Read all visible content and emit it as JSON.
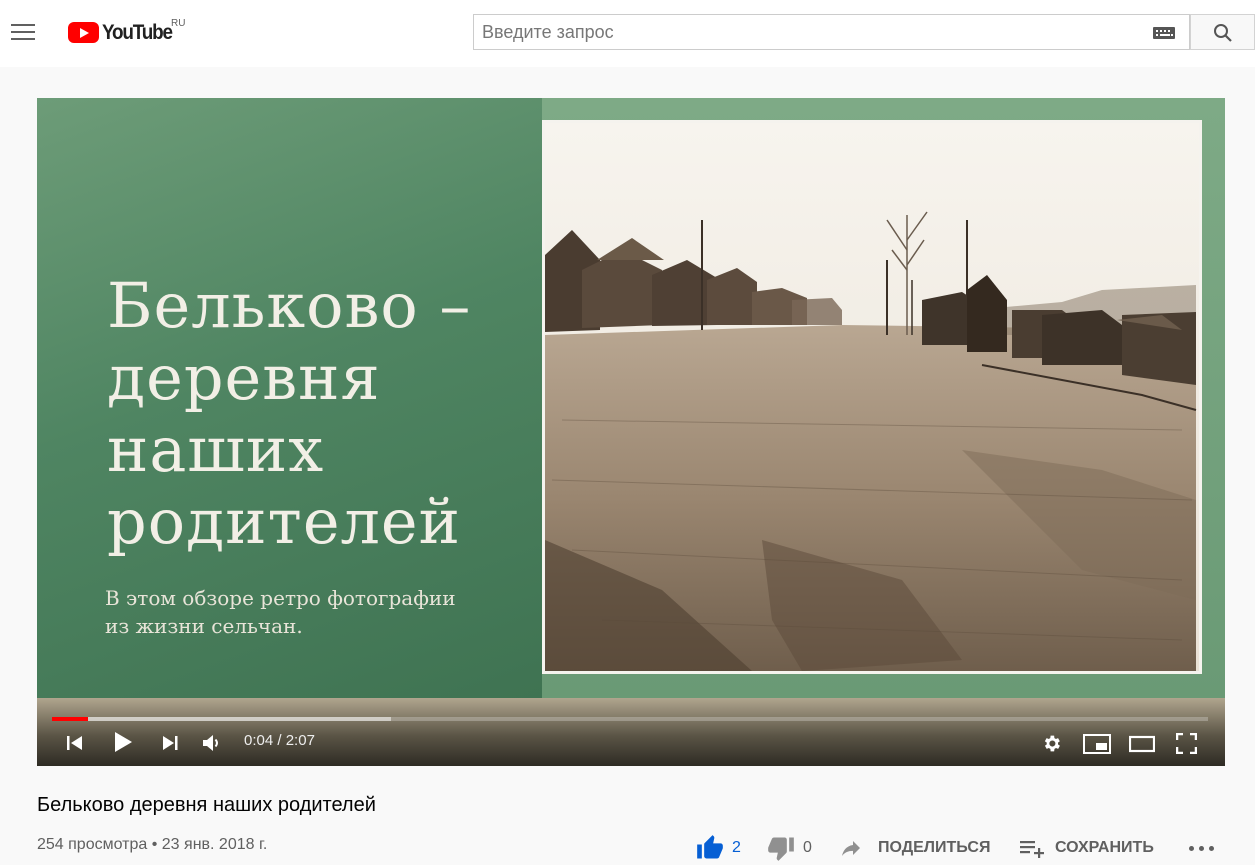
{
  "header": {
    "logo_text": "YouTube",
    "country_code": "RU",
    "search_placeholder": "Введите запрос"
  },
  "player": {
    "slide_title_lines": [
      "Бельково –",
      "деревня",
      "наших",
      "родителей"
    ],
    "slide_subtitle_lines": [
      "В этом обзоре ретро фотографии",
      "из жизни сельчан."
    ],
    "current_time": "0:04",
    "duration": "2:07",
    "time_separator": " / ",
    "progress_played_fraction": 0.031,
    "progress_loaded_fraction": 0.293,
    "icons": [
      "previous-icon",
      "play-icon",
      "next-icon",
      "volume-icon",
      "settings-gear-icon",
      "miniplayer-icon",
      "theater-mode-icon",
      "fullscreen-icon"
    ]
  },
  "video": {
    "title": "Бельково деревня наших родителей",
    "views": "254 просмотра",
    "separator": " • ",
    "date": "23 янв. 2018 г."
  },
  "actions": {
    "likes": "2",
    "dislikes": "0",
    "share_label": "ПОДЕЛИТЬСЯ",
    "save_label": "СОХРАНИТЬ"
  },
  "colors": {
    "brand_red": "#ff0000",
    "like_blue": "#065fd4",
    "slide_green": "#5b8f6a"
  }
}
